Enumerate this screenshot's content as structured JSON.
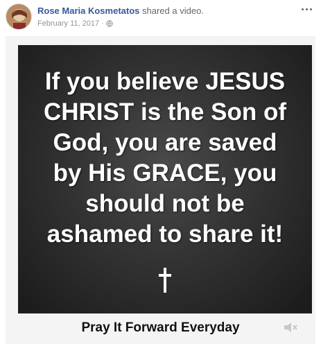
{
  "post": {
    "author": "Rose Maria Kosmetatos",
    "action": "shared a video.",
    "date": "February 11, 2017",
    "separator": "·",
    "privacy_icon": "globe-icon",
    "more_icon": "more-options-icon"
  },
  "video": {
    "poster_lines": [
      "If you believe JESUS",
      "CHRIST is the Son of",
      "God, you are saved",
      "by His GRACE, you",
      "should not be",
      "ashamed to share it!"
    ],
    "caption": "Pray It Forward Everyday",
    "symbol_icon": "cross-icon",
    "volume_icon": "volume-muted-icon"
  },
  "colors": {
    "name_link": "#365899",
    "meta_text": "#90949c",
    "poster_bg": "#333333"
  }
}
